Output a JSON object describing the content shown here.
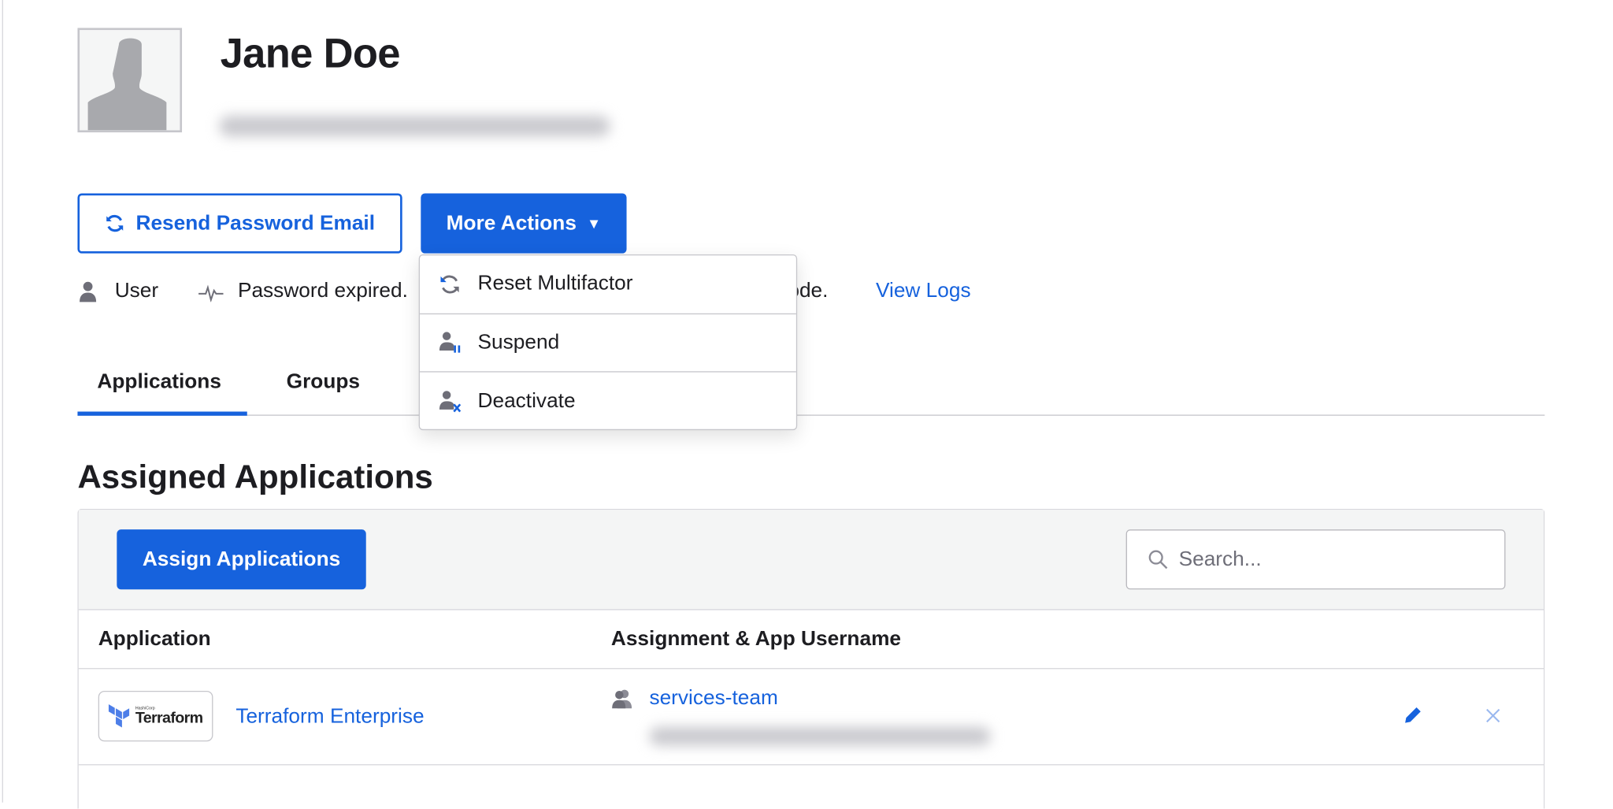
{
  "profile": {
    "name": "Jane Doe",
    "email_blurred": true
  },
  "actions": {
    "resend_label": "Resend Password Email",
    "more_label": "More Actions",
    "more_caret": "▼"
  },
  "menu": {
    "items": [
      {
        "label": "Reset Multifactor",
        "icon": "refresh-icon"
      },
      {
        "label": "Suspend",
        "icon": "user-suspend-icon"
      },
      {
        "label": "Deactivate",
        "icon": "user-deactivate-icon"
      }
    ]
  },
  "status": {
    "role": "User",
    "password": "Password expired.",
    "truncated_fragment": "ode.",
    "view_logs": "View Logs"
  },
  "tabs": [
    {
      "label": "Applications",
      "active": true
    },
    {
      "label": "Groups",
      "active": false
    }
  ],
  "section": {
    "title": "Assigned Applications",
    "assign_label": "Assign Applications",
    "search_placeholder": "Search..."
  },
  "table": {
    "headers": [
      "Application",
      "Assignment & App Username"
    ],
    "rows": [
      {
        "logo_small": "HashiCorp",
        "logo_text": "Terraform",
        "app": "Terraform Enterprise",
        "assignment": "services-team",
        "username_blurred": true
      }
    ]
  },
  "colors": {
    "accent": "#1662dd",
    "text": "#1d1d21",
    "border": "#c6c6cb",
    "toolbar_bg": "#f4f5f5"
  }
}
